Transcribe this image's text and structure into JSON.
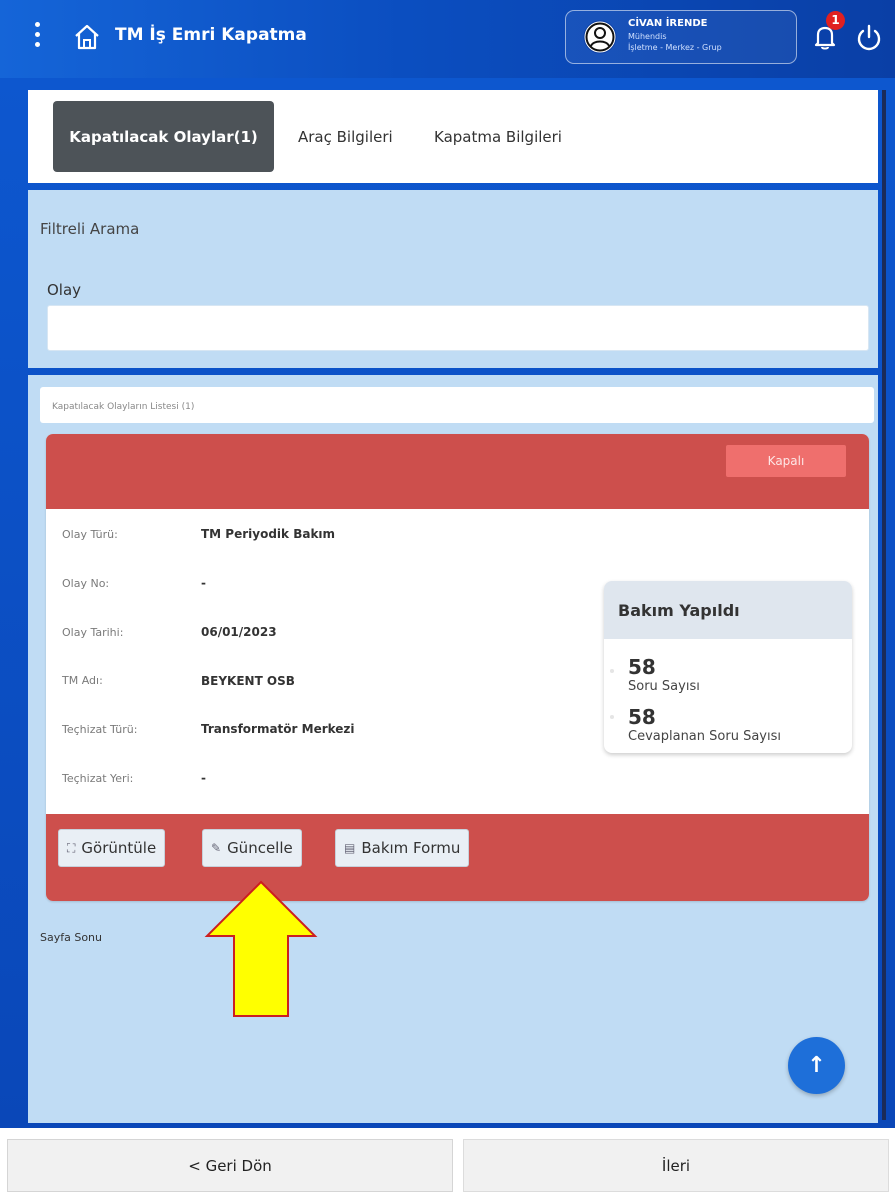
{
  "app": {
    "title": "TM İş Emri Kapatma"
  },
  "user": {
    "name": "CİVAN İRENDE",
    "role": "Mühendis",
    "org": "İşletme - Merkez - Grup"
  },
  "notifications": {
    "count": "1"
  },
  "tabs": [
    {
      "label": "Kapatılacak Olaylar(1)",
      "active": true
    },
    {
      "label": "Araç Bilgileri",
      "active": false
    },
    {
      "label": "Kapatma Bilgileri",
      "active": false
    }
  ],
  "filter": {
    "title": "Filtreli Arama",
    "olay_label": "Olay",
    "olay_value": ""
  },
  "list": {
    "header": "Kapatılacak Olayların Listesi (1)"
  },
  "record": {
    "status": "Kapalı",
    "fields": [
      {
        "label": "Olay Türü:",
        "value": "TM Periyodik Bakım"
      },
      {
        "label": "Olay No:",
        "value": "-"
      },
      {
        "label": "Olay Tarihi:",
        "value": "06/01/2023"
      },
      {
        "label": "TM Adı:",
        "value": "BEYKENT OSB"
      },
      {
        "label": "Teçhizat Türü:",
        "value": "Transformatör Merkezi"
      },
      {
        "label": "Teçhizat Yeri:",
        "value": "-"
      }
    ],
    "stats": {
      "title": "Bakım Yapıldı",
      "question_count": "58",
      "question_label": "Soru Sayısı",
      "answered_count": "58",
      "answered_label": "Cevaplanan Soru Sayısı"
    },
    "actions": {
      "view": "Görüntüle",
      "update": "Güncelle",
      "form": "Bakım Formu"
    }
  },
  "page_end": "Sayfa Sonu",
  "footer": {
    "back": "< Geri Dön",
    "next": "İleri"
  },
  "colors": {
    "header_blue": "#0b4ec0",
    "panel_blue": "#c0dcf4",
    "card_red": "#cd4f4c",
    "status_red": "#ef6f6d",
    "arrow_yellow": "#ffff00"
  }
}
